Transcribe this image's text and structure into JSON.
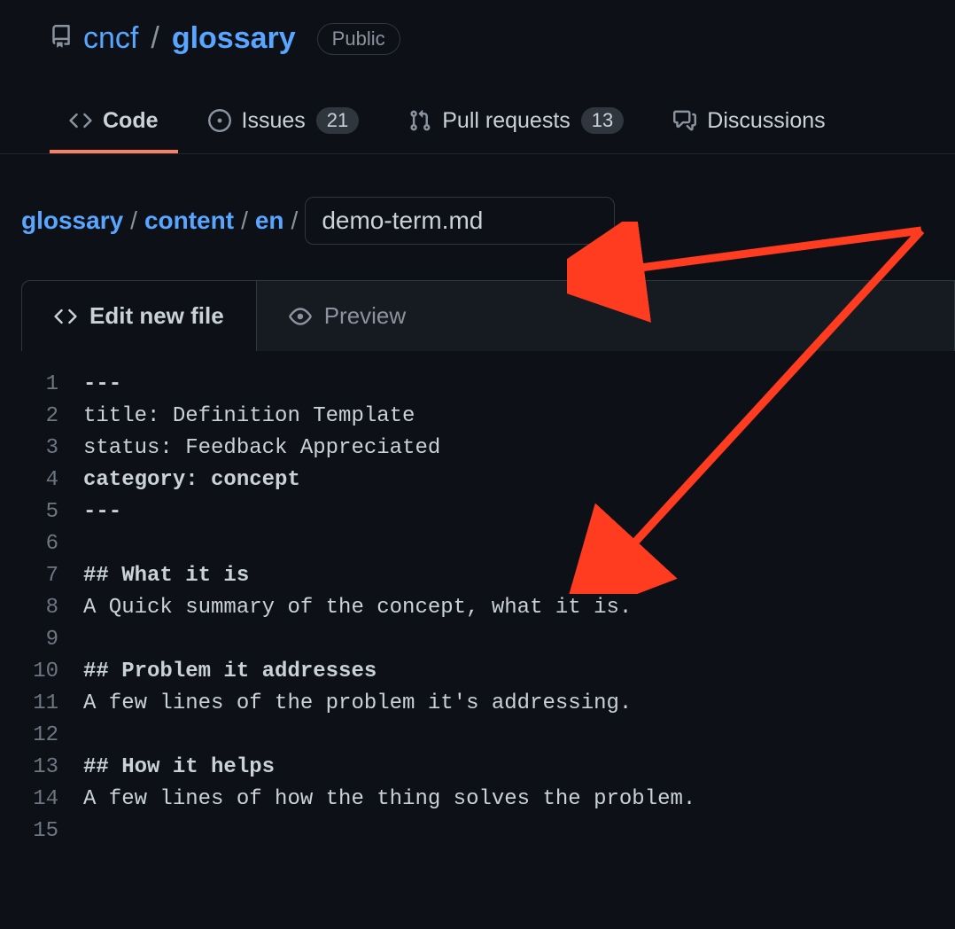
{
  "repo": {
    "owner": "cncf",
    "name": "glossary",
    "visibility": "Public"
  },
  "nav": {
    "code": "Code",
    "issues": "Issues",
    "issues_count": "21",
    "pulls": "Pull requests",
    "pulls_count": "13",
    "discussions": "Discussions"
  },
  "path": {
    "seg0": "glossary",
    "seg1": "content",
    "seg2": "en",
    "filename": "demo-term.md"
  },
  "editor": {
    "edit_tab": "Edit new file",
    "preview_tab": "Preview",
    "lines": {
      "n1": "1",
      "l1": "---",
      "n2": "2",
      "l2": "title: Definition Template",
      "n3": "3",
      "l3": "status: Feedback Appreciated",
      "n4": "4",
      "l4": "category: concept",
      "n5": "5",
      "l5": "---",
      "n6": "6",
      "l6": "",
      "n7": "7",
      "l7": "## What it is",
      "n8": "8",
      "l8": "A Quick summary of the concept, what it is.",
      "n9": "9",
      "l9": "",
      "n10": "10",
      "l10": "## Problem it addresses",
      "n11": "11",
      "l11": "A few lines of the problem it's addressing.",
      "n12": "12",
      "l12": "",
      "n13": "13",
      "l13": "## How it helps",
      "n14": "14",
      "l14": "A few lines of how the thing solves the problem.",
      "n15": "15",
      "l15": ""
    }
  }
}
